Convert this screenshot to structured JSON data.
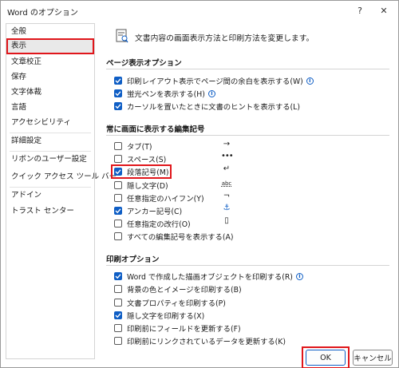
{
  "window": {
    "title": "Word のオプション",
    "help_glyph": "?",
    "close_glyph": "✕"
  },
  "sidebar": {
    "items": [
      "全般",
      "表示",
      "文章校正",
      "保存",
      "文字体裁",
      "言語",
      "アクセシビリティ",
      "詳細設定",
      "リボンのユーザー設定",
      "クイック アクセス ツール バー",
      "アドイン",
      "トラスト センター"
    ],
    "selected": "表示"
  },
  "header": {
    "text": "文書内容の画面表示方法と印刷方法を変更します。"
  },
  "page_display": {
    "title": "ページ表示オプション",
    "options": [
      {
        "label": "印刷レイアウト表示でページ間の余白を表示する(W)",
        "checked": true,
        "info": true
      },
      {
        "label": "蛍光ペンを表示する(H)",
        "checked": true,
        "info": true
      },
      {
        "label": "カーソルを置いたときに文書のヒントを表示する(L)",
        "checked": true,
        "info": false
      }
    ]
  },
  "format_marks": {
    "title": "常に画面に表示する編集記号",
    "options": [
      {
        "label": "タブ(T)",
        "checked": false,
        "symbol": "→"
      },
      {
        "label": "スペース(S)",
        "checked": false,
        "symbol": "•••"
      },
      {
        "label": "段落記号(M)",
        "checked": true,
        "symbol": "↵"
      },
      {
        "label": "隠し文字(D)",
        "checked": false,
        "symbol": "abc"
      },
      {
        "label": "任意指定のハイフン(Y)",
        "checked": false,
        "symbol": "¬"
      },
      {
        "label": "アンカー記号(C)",
        "checked": true,
        "symbol": "⚓"
      },
      {
        "label": "任意指定の改行(O)",
        "checked": false,
        "symbol": "▯"
      },
      {
        "label": "すべての編集記号を表示する(A)",
        "checked": false,
        "symbol": ""
      }
    ]
  },
  "print": {
    "title": "印刷オプション",
    "options": [
      {
        "label": "Word で作成した描画オブジェクトを印刷する(R)",
        "checked": true,
        "info": true
      },
      {
        "label": "背景の色とイメージを印刷する(B)",
        "checked": false,
        "info": false
      },
      {
        "label": "文書プロパティを印刷する(P)",
        "checked": false,
        "info": false
      },
      {
        "label": "隠し文字を印刷する(X)",
        "checked": true,
        "info": false
      },
      {
        "label": "印刷前にフィールドを更新する(F)",
        "checked": false,
        "info": false
      },
      {
        "label": "印刷前にリンクされているデータを更新する(K)",
        "checked": false,
        "info": false
      }
    ]
  },
  "footer": {
    "ok_label": "OK",
    "cancel_label": "キャンセル"
  },
  "colors": {
    "accent": "#0f5ec5",
    "highlight": "#e0161b",
    "selected_bg": "#e9e9e9"
  }
}
